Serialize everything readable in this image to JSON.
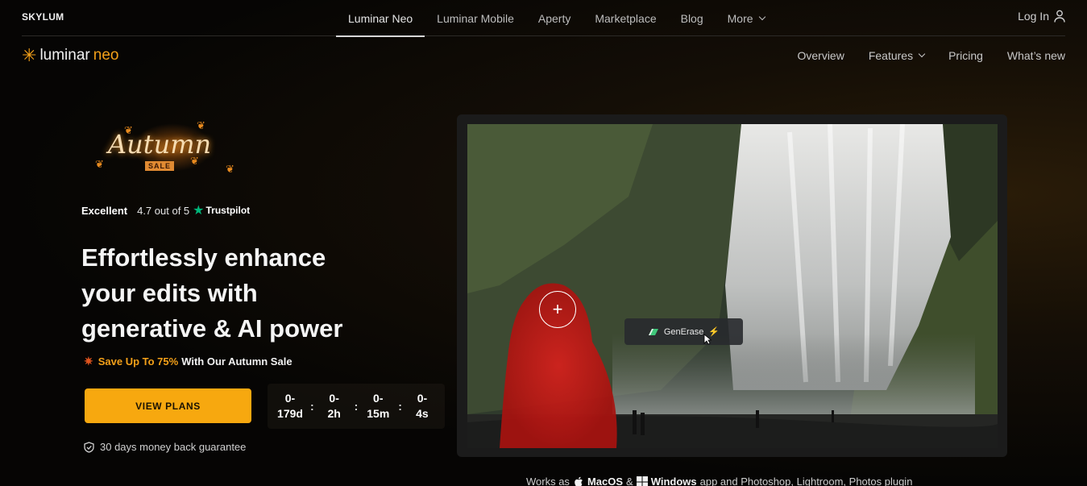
{
  "header": {
    "brand": "SKYLUM",
    "nav": [
      {
        "label": "Luminar Neo"
      },
      {
        "label": "Luminar Mobile"
      },
      {
        "label": "Aperty"
      },
      {
        "label": "Marketplace"
      },
      {
        "label": "Blog"
      },
      {
        "label": "More"
      }
    ],
    "login_label": "Log In"
  },
  "subheader": {
    "logo_word1": "luminar",
    "logo_word2": "neo",
    "nav": [
      {
        "label": "Overview"
      },
      {
        "label": "Features"
      },
      {
        "label": "Pricing"
      },
      {
        "label": "What’s new"
      }
    ]
  },
  "promo": {
    "word": "Autumn",
    "tag": "SALE"
  },
  "rating": {
    "label": "Excellent",
    "score": "4.7 out of 5",
    "provider": "Trustpilot"
  },
  "hero": {
    "line1": "Effortlessly enhance",
    "line2": "your edits with",
    "line3": "generative & AI power"
  },
  "sale": {
    "highlight": "Save Up To 75%",
    "rest": "With Our Autumn Sale"
  },
  "cta": {
    "label": "VIEW PLANS"
  },
  "timer": {
    "days": {
      "value": "0-",
      "unit": "179d"
    },
    "hours": {
      "value": "0-",
      "unit": "2h"
    },
    "minutes": {
      "value": "0-",
      "unit": "15m"
    },
    "seconds": {
      "value": "0-",
      "unit": "4s"
    },
    "separator": ":"
  },
  "guarantee": {
    "label": "30 days money back guarantee"
  },
  "media": {
    "tool_label": "GenErase"
  },
  "works": {
    "prefix": "Works as",
    "os1": "MacOS",
    "amp": "&",
    "os2": "Windows",
    "suffix": "app and Photoshop, Lightroom, Photos plugin"
  },
  "colors": {
    "accent": "#f7a80f",
    "trustpilot": "#00b67a",
    "sale_icon": "#e0541e"
  }
}
